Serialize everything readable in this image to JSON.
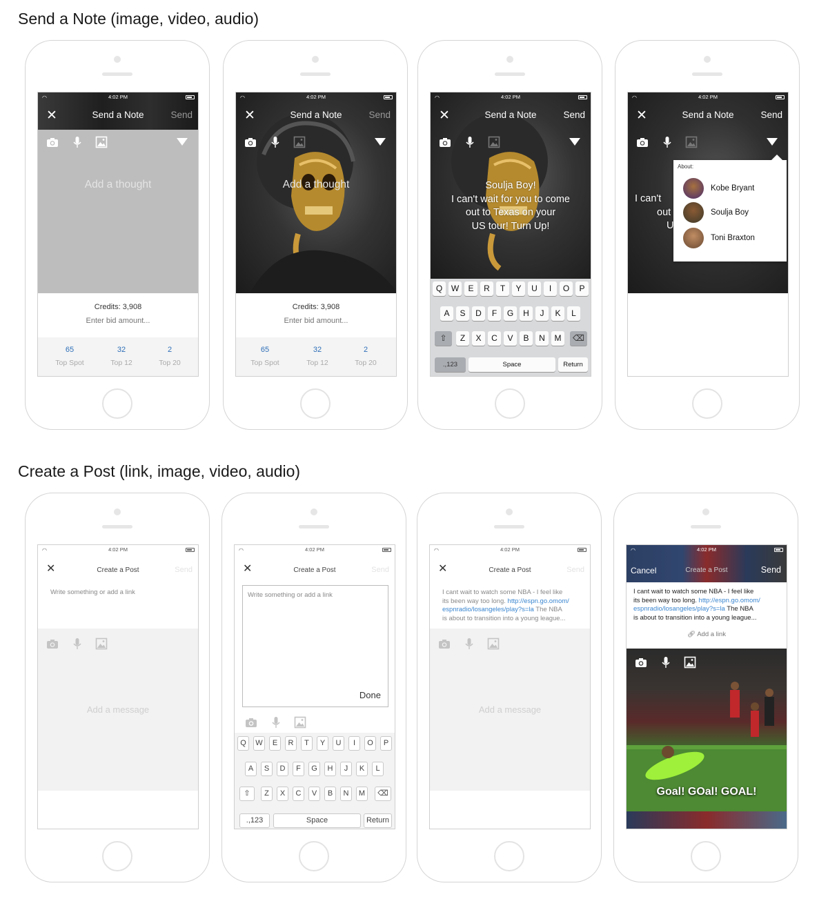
{
  "sections": {
    "note_title": "Send a Note (image, video, audio)",
    "post_title": "Create a Post (link, image, video, audio)"
  },
  "status": {
    "time": "4:02 PM"
  },
  "note": {
    "title": "Send a Note",
    "send": "Send",
    "placeholder": "Add a thought",
    "credits": "Credits: 3,908",
    "bid_placeholder": "Enter bid amount...",
    "spots": [
      {
        "value": "65",
        "label": "Top Spot"
      },
      {
        "value": "32",
        "label": "Top 12"
      },
      {
        "value": "2",
        "label": "Top 20"
      }
    ],
    "message": [
      "Soulja Boy!",
      "I can't wait for you to come",
      "out to Texas on your",
      "US tour! Turn Up!"
    ],
    "about_label": "About:",
    "people": [
      "Kobe Bryant",
      "Soulja Boy",
      "Toni Braxton"
    ],
    "partial_lines": [
      "I can't",
      "out",
      "U"
    ]
  },
  "post": {
    "title": "Create a Post",
    "send": "Send",
    "cancel": "Cancel",
    "placeholder": "Write something or add a link",
    "message_placeholder": "Add a message",
    "done": "Done",
    "add_link": "Add a link",
    "text_before": "I cant wait to watch some NBA - I feel like its been way too long. ",
    "text_link": "http://espn.go.omom/espnradio/losangeles/play?s=la",
    "text_after": " The NBA is about to transition into a young league...",
    "lines_a": [
      "I cant wait to watch some NBA - I feel like",
      "its been way too long. "
    ],
    "link_a": [
      "http://espn.go.omom/",
      "espnradio/losangeles/play?s=la"
    ],
    "after_a": [
      " The NBA",
      "is about to transition into a young league..."
    ],
    "goal_caption": "Goal! GOal! GOAL!"
  },
  "keyboard": {
    "row1": [
      "Q",
      "W",
      "E",
      "R",
      "T",
      "Y",
      "U",
      "I",
      "O",
      "P"
    ],
    "row2": [
      "A",
      "S",
      "D",
      "F",
      "G",
      "H",
      "J",
      "K",
      "L"
    ],
    "row3": [
      "Z",
      "X",
      "C",
      "V",
      "B",
      "N",
      "M"
    ],
    "num": ".,123",
    "space": "Space",
    "ret": "Return"
  },
  "colors": {
    "accent_link": "#3a86d0",
    "spot_value": "#2e6fb8"
  },
  "icons": [
    "close-icon",
    "camera-icon",
    "microphone-icon",
    "image-icon",
    "dropdown-arrow-icon",
    "wifi-icon",
    "battery-icon",
    "shift-icon",
    "backspace-icon",
    "link-icon"
  ]
}
